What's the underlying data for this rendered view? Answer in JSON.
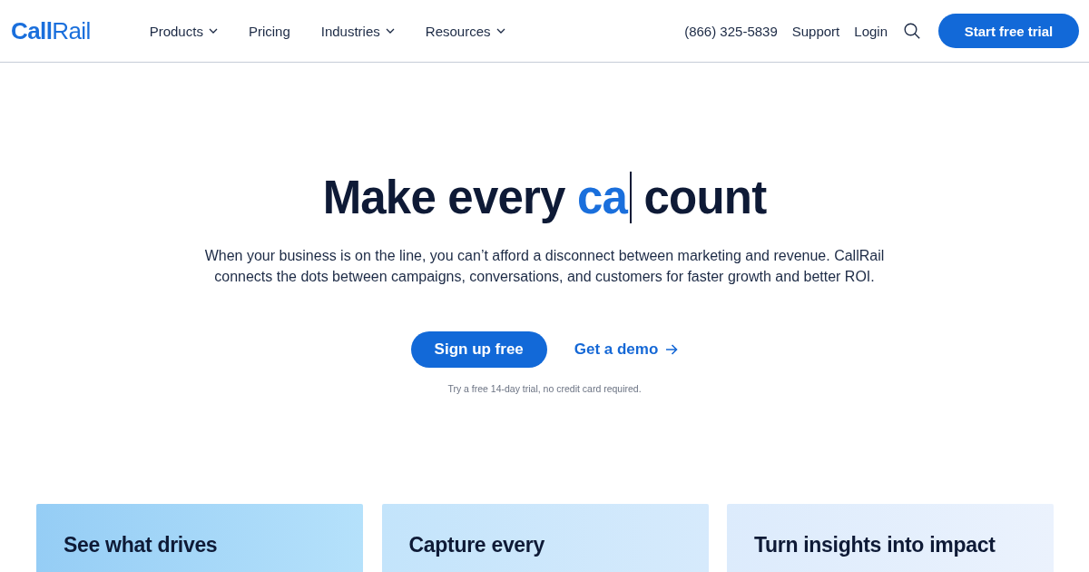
{
  "header": {
    "logo": "**Call**Rail",
    "nav": [
      {
        "label": "Products",
        "dropdown": true
      },
      {
        "label": "Pricing",
        "dropdown": false
      },
      {
        "label": "Industries",
        "dropdown": true
      },
      {
        "label": "Resources",
        "dropdown": true
      }
    ],
    "phone": "(866) 325-5839",
    "links": [
      "Support",
      "Login"
    ],
    "cta": "Start free trial"
  },
  "hero": {
    "heading": {
      "before": "Make every",
      "typed": "ca",
      "after": "count",
      "cursor": true
    },
    "description": "When your business is on the line, you can’t afford a disconnect between marketing and revenue. CallRail connects the dots between campaigns, conversations, and customers for faster growth and better ROI.",
    "primary_button": "Sign up free",
    "demo_link": "Get a demo",
    "note": "Try a free 14-day trial, no credit card required."
  },
  "cards": [
    {
      "title": "See what drives"
    },
    {
      "title": "Capture every"
    },
    {
      "title": "Turn insights into impact"
    }
  ]
}
